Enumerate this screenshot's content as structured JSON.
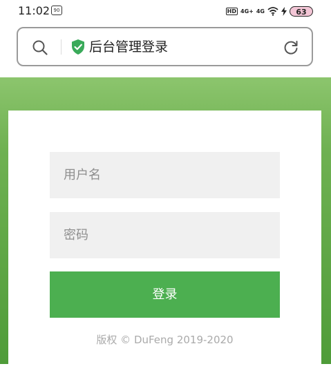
{
  "status_bar": {
    "time": "11:02",
    "app_icon_glyph": "90",
    "hd_label": "HD",
    "signal_1": "4G+",
    "signal_2": "4G",
    "battery": "63"
  },
  "url_bar": {
    "title": "后台管理登录",
    "icons": [
      "search-icon",
      "shield-check-icon",
      "reload-icon"
    ],
    "shield_color": "#3aaa5a"
  },
  "form": {
    "username_placeholder": "用户名",
    "password_placeholder": "密码",
    "login_label": "登录",
    "button_color": "#4caf50",
    "background_color": "#6fb152"
  },
  "footer": {
    "copyright": "版权 © DuFeng 2019-2020"
  }
}
